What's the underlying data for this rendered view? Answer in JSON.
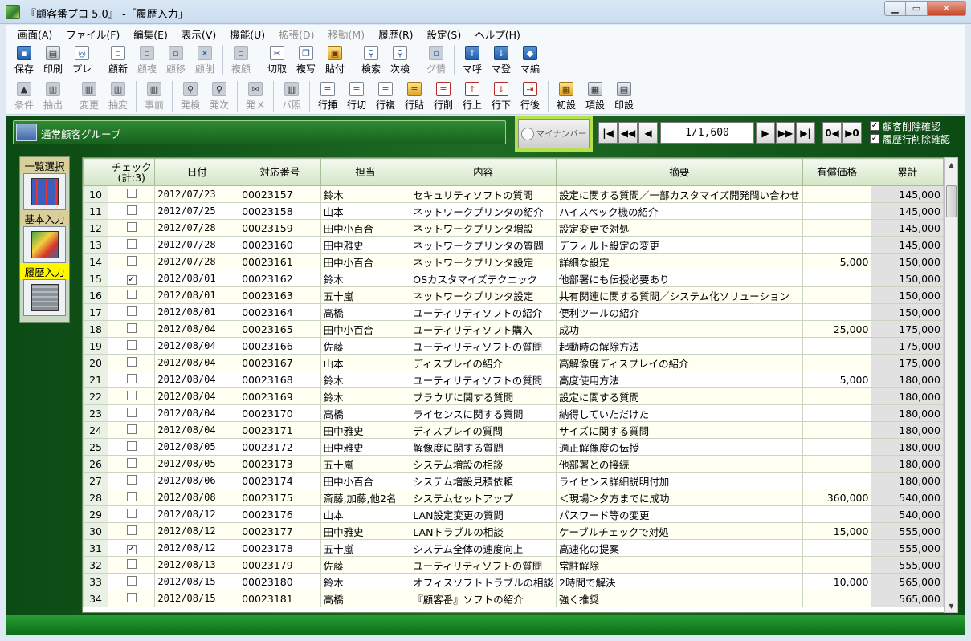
{
  "window": {
    "title": "『顧客番プロ 5.0』 ‐「履歴入力」"
  },
  "menu": [
    "画面(A)",
    "ファイル(F)",
    "編集(E)",
    "表示(V)",
    "機能(U)",
    "拡張(D)",
    "移動(M)",
    "履歴(R)",
    "設定(S)",
    "ヘルプ(H)"
  ],
  "menu_disabled": [
    false,
    false,
    false,
    false,
    false,
    true,
    true,
    false,
    false,
    false
  ],
  "toolbar1": [
    {
      "label": "保存",
      "icon": "save-icon",
      "style": "ic-blue",
      "glyph": "▪",
      "disabled": false
    },
    {
      "label": "印刷",
      "icon": "print-icon",
      "style": "ic-gray",
      "glyph": "▤",
      "disabled": false
    },
    {
      "label": "プレ",
      "icon": "preview-icon",
      "style": "ic-doc",
      "glyph": "◎",
      "disabled": false
    },
    {
      "sep": true
    },
    {
      "label": "顧新",
      "icon": "new-customer-icon",
      "style": "ic-doc",
      "glyph": "▫",
      "disabled": false
    },
    {
      "label": "顧複",
      "icon": "copy-customer-icon",
      "style": "ic-doc",
      "glyph": "▫",
      "disabled": true
    },
    {
      "label": "顧移",
      "icon": "move-customer-icon",
      "style": "ic-doc",
      "glyph": "▫",
      "disabled": true
    },
    {
      "label": "顧削",
      "icon": "delete-customer-icon",
      "style": "ic-doc",
      "glyph": "✕",
      "disabled": true
    },
    {
      "sep": true
    },
    {
      "label": "複顧",
      "icon": "multi-customer-icon",
      "style": "ic-doc",
      "glyph": "▫",
      "disabled": true
    },
    {
      "sep": true
    },
    {
      "label": "切取",
      "icon": "cut-icon",
      "style": "ic-doc",
      "glyph": "✂",
      "disabled": false
    },
    {
      "label": "複写",
      "icon": "copy-icon",
      "style": "ic-doc",
      "glyph": "❐",
      "disabled": false
    },
    {
      "label": "貼付",
      "icon": "paste-icon",
      "style": "ic-yellow",
      "glyph": "▣",
      "disabled": false
    },
    {
      "sep": true
    },
    {
      "label": "検索",
      "icon": "search-icon",
      "style": "ic-doc",
      "glyph": "⚲",
      "disabled": false
    },
    {
      "label": "次検",
      "icon": "search-next-icon",
      "style": "ic-doc",
      "glyph": "⚲",
      "disabled": false
    },
    {
      "sep": true
    },
    {
      "label": "グ情",
      "icon": "group-info-icon",
      "style": "ic-doc",
      "glyph": "▫",
      "disabled": true
    },
    {
      "sep": true
    },
    {
      "label": "マ呼",
      "icon": "macro-call-icon",
      "style": "ic-blue",
      "glyph": "↑",
      "disabled": false
    },
    {
      "label": "マ登",
      "icon": "macro-register-icon",
      "style": "ic-blue",
      "glyph": "↓",
      "disabled": false
    },
    {
      "label": "マ編",
      "icon": "macro-edit-icon",
      "style": "ic-blue",
      "glyph": "◆",
      "disabled": false
    }
  ],
  "toolbar2": [
    {
      "label": "条件",
      "icon": "condition-icon",
      "style": "ic-gray",
      "glyph": "▲",
      "disabled": true
    },
    {
      "label": "抽出",
      "icon": "extract-icon",
      "style": "ic-gray",
      "glyph": "▥",
      "disabled": true
    },
    {
      "sep": true
    },
    {
      "label": "変更",
      "icon": "change-icon",
      "style": "ic-gray",
      "glyph": "▥",
      "disabled": true
    },
    {
      "label": "抽変",
      "icon": "extract-change-icon",
      "style": "ic-gray",
      "glyph": "▥",
      "disabled": true
    },
    {
      "sep": true
    },
    {
      "label": "事前",
      "icon": "advance-icon",
      "style": "ic-gray",
      "glyph": "▥",
      "disabled": true
    },
    {
      "sep": true
    },
    {
      "label": "発検",
      "icon": "issue-search-icon",
      "style": "ic-gray",
      "glyph": "⚲",
      "disabled": true
    },
    {
      "label": "発次",
      "icon": "issue-next-icon",
      "style": "ic-gray",
      "glyph": "⚲",
      "disabled": true
    },
    {
      "sep": true
    },
    {
      "label": "発メ",
      "icon": "issue-mail-icon",
      "style": "ic-gray",
      "glyph": "✉",
      "disabled": true
    },
    {
      "sep": true
    },
    {
      "label": "バ照",
      "icon": "barcode-icon",
      "style": "ic-gray",
      "glyph": "▥",
      "disabled": true
    },
    {
      "sep": true
    },
    {
      "label": "行挿",
      "icon": "row-insert-icon",
      "style": "ic-doc",
      "glyph": "≡",
      "disabled": false
    },
    {
      "label": "行切",
      "icon": "row-cut-icon",
      "style": "ic-doc",
      "glyph": "≡",
      "disabled": false
    },
    {
      "label": "行複",
      "icon": "row-copy-icon",
      "style": "ic-doc",
      "glyph": "≡",
      "disabled": false
    },
    {
      "label": "行貼",
      "icon": "row-paste-icon",
      "style": "ic-yellow",
      "glyph": "≡",
      "disabled": false
    },
    {
      "label": "行削",
      "icon": "row-delete-icon",
      "style": "ic-red",
      "glyph": "≡",
      "disabled": false
    },
    {
      "label": "行上",
      "icon": "row-up-icon",
      "style": "ic-red",
      "glyph": "↑",
      "disabled": false
    },
    {
      "label": "行下",
      "icon": "row-down-icon",
      "style": "ic-red",
      "glyph": "↓",
      "disabled": false
    },
    {
      "label": "行後",
      "icon": "row-after-icon",
      "style": "ic-red",
      "glyph": "⇥",
      "disabled": false
    },
    {
      "sep": true
    },
    {
      "label": "初設",
      "icon": "initial-setting-icon",
      "style": "ic-yellow",
      "glyph": "▦",
      "disabled": false
    },
    {
      "label": "項設",
      "icon": "item-setting-icon",
      "style": "ic-gray",
      "glyph": "▦",
      "disabled": false
    },
    {
      "label": "印設",
      "icon": "print-setting-icon",
      "style": "ic-gray",
      "glyph": "▤",
      "disabled": false
    }
  ],
  "group": {
    "label": "通常顧客グループ"
  },
  "mynumber_label": "マイナンバー",
  "navigation": {
    "position": "1/1,600"
  },
  "options": [
    {
      "label": "顧客削除確認",
      "checked": true
    },
    {
      "label": "履歴行削除確認",
      "checked": true
    }
  ],
  "leftpanel": {
    "list_select": "一覧選択",
    "basic_input": "基本入力",
    "history_input": "履歴入力"
  },
  "table": {
    "columns": [
      "",
      "チェック\n(計:3)",
      "日付",
      "対応番号",
      "担当",
      "内容",
      "摘要",
      "有償価格",
      "累計"
    ],
    "rows": [
      [
        "10",
        false,
        "2012/07/23",
        "00023157",
        "鈴木",
        "セキュリティソフトの質問",
        "設定に関する質問／一部カスタマイズ開発問い合わせ",
        "",
        "145,000"
      ],
      [
        "11",
        false,
        "2012/07/25",
        "00023158",
        "山本",
        "ネットワークプリンタの紹介",
        "ハイスペック機の紹介",
        "",
        "145,000"
      ],
      [
        "12",
        false,
        "2012/07/28",
        "00023159",
        "田中小百合",
        "ネットワークプリンタ増設",
        "設定変更で対処",
        "",
        "145,000"
      ],
      [
        "13",
        false,
        "2012/07/28",
        "00023160",
        "田中雅史",
        "ネットワークプリンタの質問",
        "デフォルト設定の変更",
        "",
        "145,000"
      ],
      [
        "14",
        false,
        "2012/07/28",
        "00023161",
        "田中小百合",
        "ネットワークプリンタ設定",
        "詳細な設定",
        "5,000",
        "150,000"
      ],
      [
        "15",
        true,
        "2012/08/01",
        "00023162",
        "鈴木",
        "OSカスタマイズテクニック",
        "他部署にも伝授必要あり",
        "",
        "150,000"
      ],
      [
        "16",
        false,
        "2012/08/01",
        "00023163",
        "五十嵐",
        "ネットワークプリンタ設定",
        "共有関連に関する質問／システム化ソリューション",
        "",
        "150,000"
      ],
      [
        "17",
        false,
        "2012/08/01",
        "00023164",
        "高橋",
        "ユーティリティソフトの紹介",
        "便利ツールの紹介",
        "",
        "150,000"
      ],
      [
        "18",
        false,
        "2012/08/04",
        "00023165",
        "田中小百合",
        "ユーティリティソフト購入",
        "成功",
        "25,000",
        "175,000"
      ],
      [
        "19",
        false,
        "2012/08/04",
        "00023166",
        "佐藤",
        "ユーティリティソフトの質問",
        "起動時の解除方法",
        "",
        "175,000"
      ],
      [
        "20",
        false,
        "2012/08/04",
        "00023167",
        "山本",
        "ディスプレイの紹介",
        "高解像度ディスプレイの紹介",
        "",
        "175,000"
      ],
      [
        "21",
        false,
        "2012/08/04",
        "00023168",
        "鈴木",
        "ユーティリティソフトの質問",
        "高度使用方法",
        "5,000",
        "180,000"
      ],
      [
        "22",
        false,
        "2012/08/04",
        "00023169",
        "鈴木",
        "ブラウザに関する質問",
        "設定に関する質問",
        "",
        "180,000"
      ],
      [
        "23",
        false,
        "2012/08/04",
        "00023170",
        "高橋",
        "ライセンスに関する質問",
        "納得していただけた",
        "",
        "180,000"
      ],
      [
        "24",
        false,
        "2012/08/04",
        "00023171",
        "田中雅史",
        "ディスプレイの質問",
        "サイズに関する質問",
        "",
        "180,000"
      ],
      [
        "25",
        false,
        "2012/08/05",
        "00023172",
        "田中雅史",
        "解像度に関する質問",
        "適正解像度の伝授",
        "",
        "180,000"
      ],
      [
        "26",
        false,
        "2012/08/05",
        "00023173",
        "五十嵐",
        "システム増設の相談",
        "他部署との接続",
        "",
        "180,000"
      ],
      [
        "27",
        false,
        "2012/08/06",
        "00023174",
        "田中小百合",
        "システム増設見積依頼",
        "ライセンス詳細説明付加",
        "",
        "180,000"
      ],
      [
        "28",
        false,
        "2012/08/08",
        "00023175",
        "斎藤,加藤,他2名",
        "システムセットアップ",
        "＜現場＞夕方までに成功",
        "360,000",
        "540,000"
      ],
      [
        "29",
        false,
        "2012/08/12",
        "00023176",
        "山本",
        "LAN設定変更の質問",
        "パスワード等の変更",
        "",
        "540,000"
      ],
      [
        "30",
        false,
        "2012/08/12",
        "00023177",
        "田中雅史",
        "LANトラブルの相談",
        "ケーブルチェックで対処",
        "15,000",
        "555,000"
      ],
      [
        "31",
        true,
        "2012/08/12",
        "00023178",
        "五十嵐",
        "システム全体の速度向上",
        "高速化の提案",
        "",
        "555,000"
      ],
      [
        "32",
        false,
        "2012/08/13",
        "00023179",
        "佐藤",
        "ユーティリティソフトの質問",
        "常駐解除",
        "",
        "555,000"
      ],
      [
        "33",
        false,
        "2012/08/15",
        "00023180",
        "鈴木",
        "オフィスソフトトラブルの相談",
        "2時間で解決",
        "10,000",
        "565,000"
      ],
      [
        "34",
        false,
        "2012/08/15",
        "00023181",
        "高橋",
        "『顧客番』ソフトの紹介",
        "強く推奨",
        "",
        "565,000"
      ]
    ]
  }
}
